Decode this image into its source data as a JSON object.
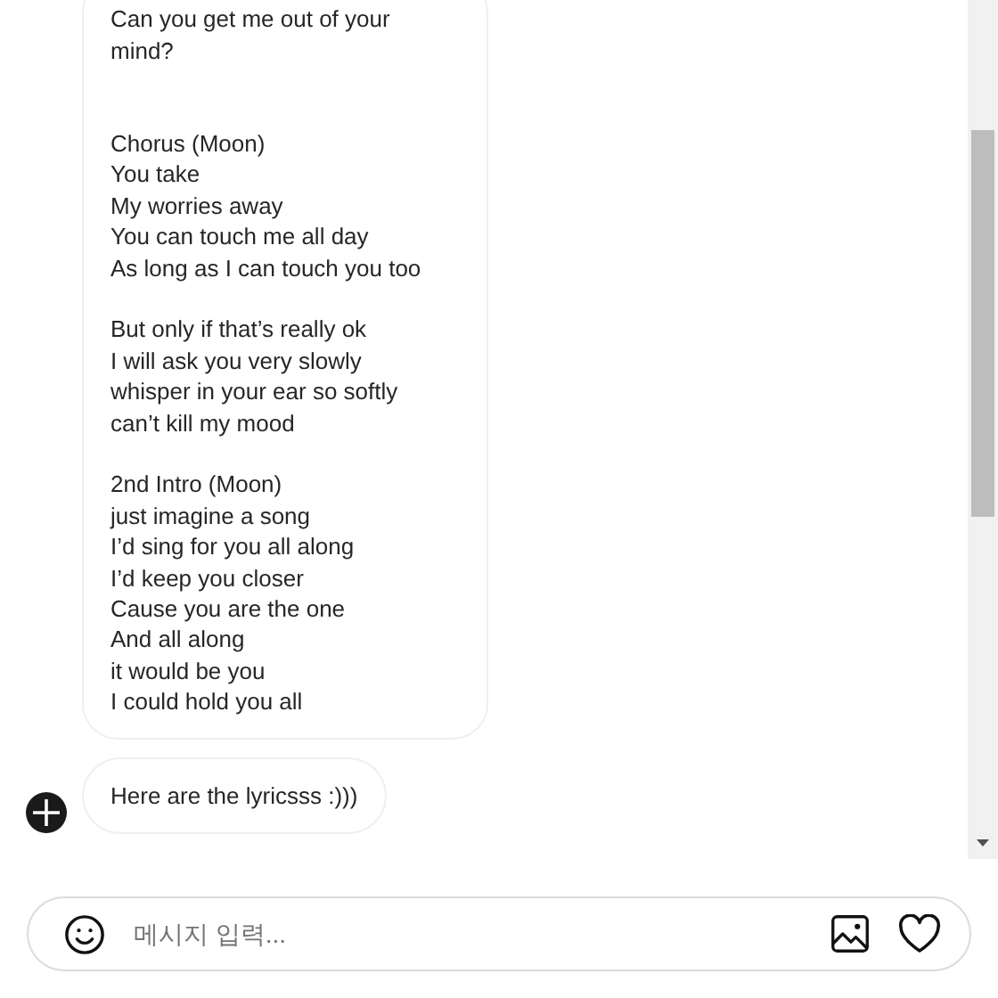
{
  "messages": [
    {
      "kind": "lyrics",
      "stanzas": [
        {
          "lines": [
            "Can you get me out of your mind?"
          ]
        },
        {
          "lines": [
            "Chorus (Moon)",
            "You take",
            "My worries away",
            "You can touch me all day",
            "As long as I can touch you too"
          ]
        },
        {
          "lines": [
            "But only if that’s really ok",
            "I will ask you very slowly",
            "whisper in your ear so softly",
            "can’t kill my mood"
          ]
        },
        {
          "lines": [
            "2nd Intro (Moon)",
            "just imagine a song",
            "I’d sing for you all along",
            "I’d keep you closer",
            "Cause you are the one",
            "And all along",
            "it would be you",
            "I could hold you all"
          ]
        }
      ]
    },
    {
      "kind": "text",
      "text": "Here are the lyricsss :)))"
    }
  ],
  "composer": {
    "placeholder": "메시지 입력..."
  }
}
